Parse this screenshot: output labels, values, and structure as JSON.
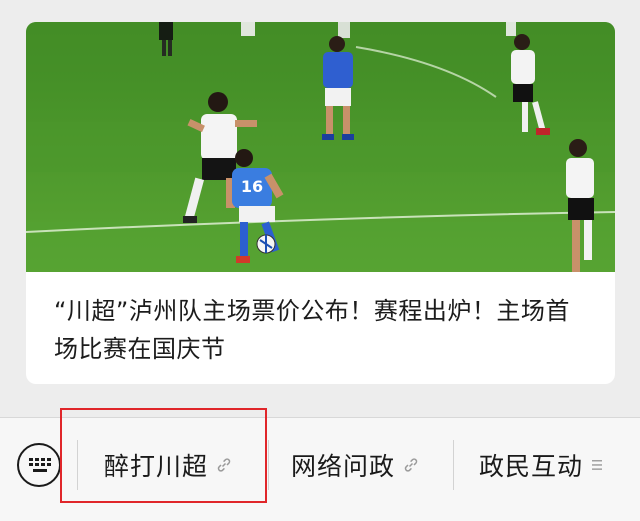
{
  "article": {
    "headline": "“川超”泸州队主场票价公布！赛程出炉！主场首场比赛在国庆节"
  },
  "menu": {
    "items": [
      {
        "label": "醉打川超",
        "icon": "link-icon"
      },
      {
        "label": "网络问政",
        "icon": "link-icon"
      },
      {
        "label": "政民互动",
        "icon": "submenu-icon"
      }
    ]
  },
  "player_number": "16",
  "colors": {
    "highlight": "#e0262a",
    "pitch": "#4f9a2b"
  }
}
